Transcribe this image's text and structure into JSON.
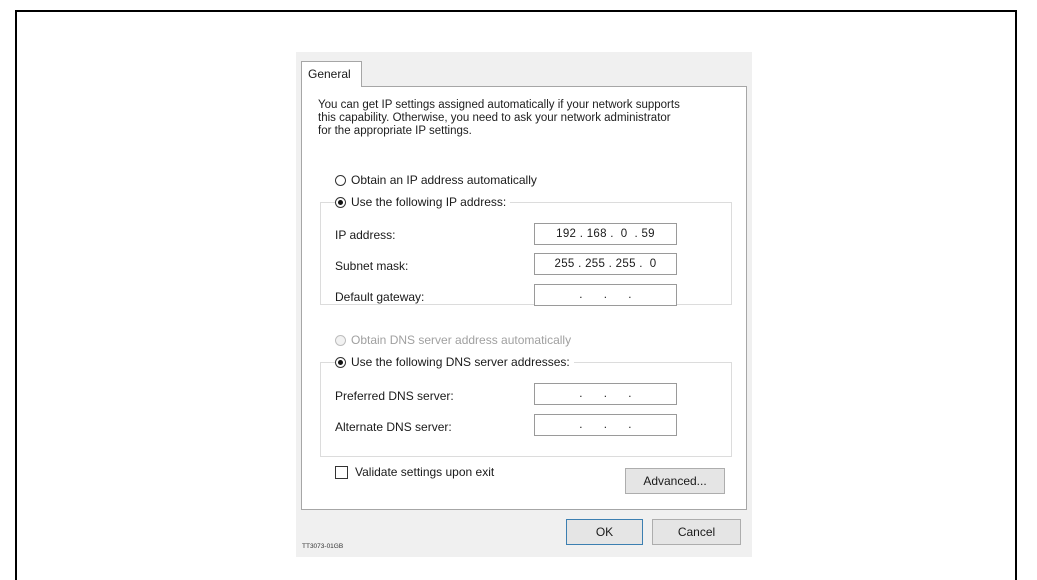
{
  "tab": {
    "label": "General"
  },
  "intro": {
    "line1": "You can get IP settings assigned automatically if your network supports",
    "line2": "this capability. Otherwise, you need to ask your network administrator",
    "line3": "for the appropriate IP settings."
  },
  "ip_mode": {
    "auto_label": "Obtain an IP address automatically",
    "manual_label": "Use the following IP address:",
    "selected": "manual"
  },
  "ip_fields": {
    "ip_address": {
      "label": "IP address:",
      "value": "192 . 168 .  0  . 59"
    },
    "subnet_mask": {
      "label": "Subnet mask:",
      "value": "255 . 255 . 255 .  0"
    },
    "default_gateway": {
      "label": "Default gateway:",
      "value": " .      .      . "
    }
  },
  "dns_mode": {
    "auto_label": "Obtain DNS server address automatically",
    "manual_label": "Use the following DNS server addresses:",
    "selected": "manual",
    "auto_disabled": true
  },
  "dns_fields": {
    "preferred": {
      "label": "Preferred DNS server:",
      "value": " .      .      . "
    },
    "alternate": {
      "label": "Alternate DNS server:",
      "value": " .      .      . "
    }
  },
  "validate": {
    "label": "Validate settings upon exit",
    "checked": false
  },
  "buttons": {
    "advanced": "Advanced...",
    "ok": "OK",
    "cancel": "Cancel"
  },
  "caption": "TT3073-01GB",
  "colors": {
    "dialog_bg": "#f0f0f0",
    "panel_bg": "#ffffff",
    "default_button_border": "#3c7fb1",
    "disabled_text": "#a0a0a0"
  }
}
